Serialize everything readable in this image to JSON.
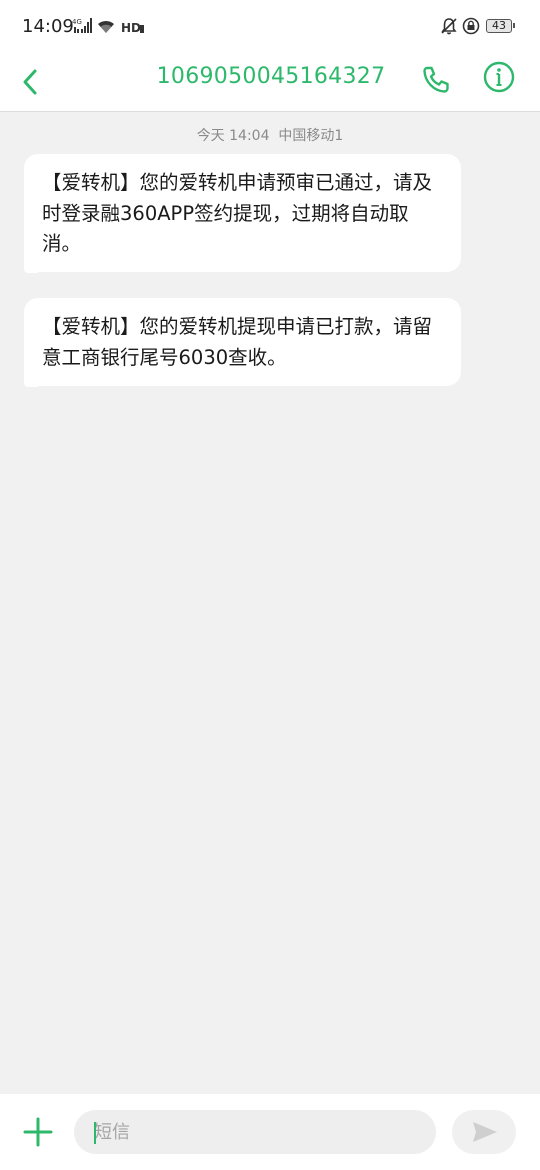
{
  "status_bar": {
    "time": "14:09",
    "battery": "43",
    "icons": [
      "signal-icon",
      "wifi-icon",
      "hd-icon",
      "bell-mute-icon",
      "rotation-lock-icon",
      "battery-icon"
    ]
  },
  "header": {
    "contact_number": "1069050045164327",
    "icons": [
      "back-arrow-icon",
      "phone-icon",
      "info-icon"
    ]
  },
  "conversation": {
    "timestamp": "今天 14:04",
    "carrier": "中国移动1",
    "messages": [
      {
        "text": "【爱转机】您的爱转机申请预审已通过，请及时登录融360APP签约提现，过期将自动取消。"
      },
      {
        "text": "【爱转机】您的爱转机提现申请已打款，请留意工商银行尾号6030查收。"
      }
    ]
  },
  "compose": {
    "placeholder": "短信",
    "value": "",
    "icons": [
      "plus-icon",
      "send-icon"
    ]
  },
  "colors": {
    "accent": "#2eb86b",
    "background": "#f1f1f1",
    "bubble": "#ffffff",
    "muted_text": "#8a8a8a"
  }
}
